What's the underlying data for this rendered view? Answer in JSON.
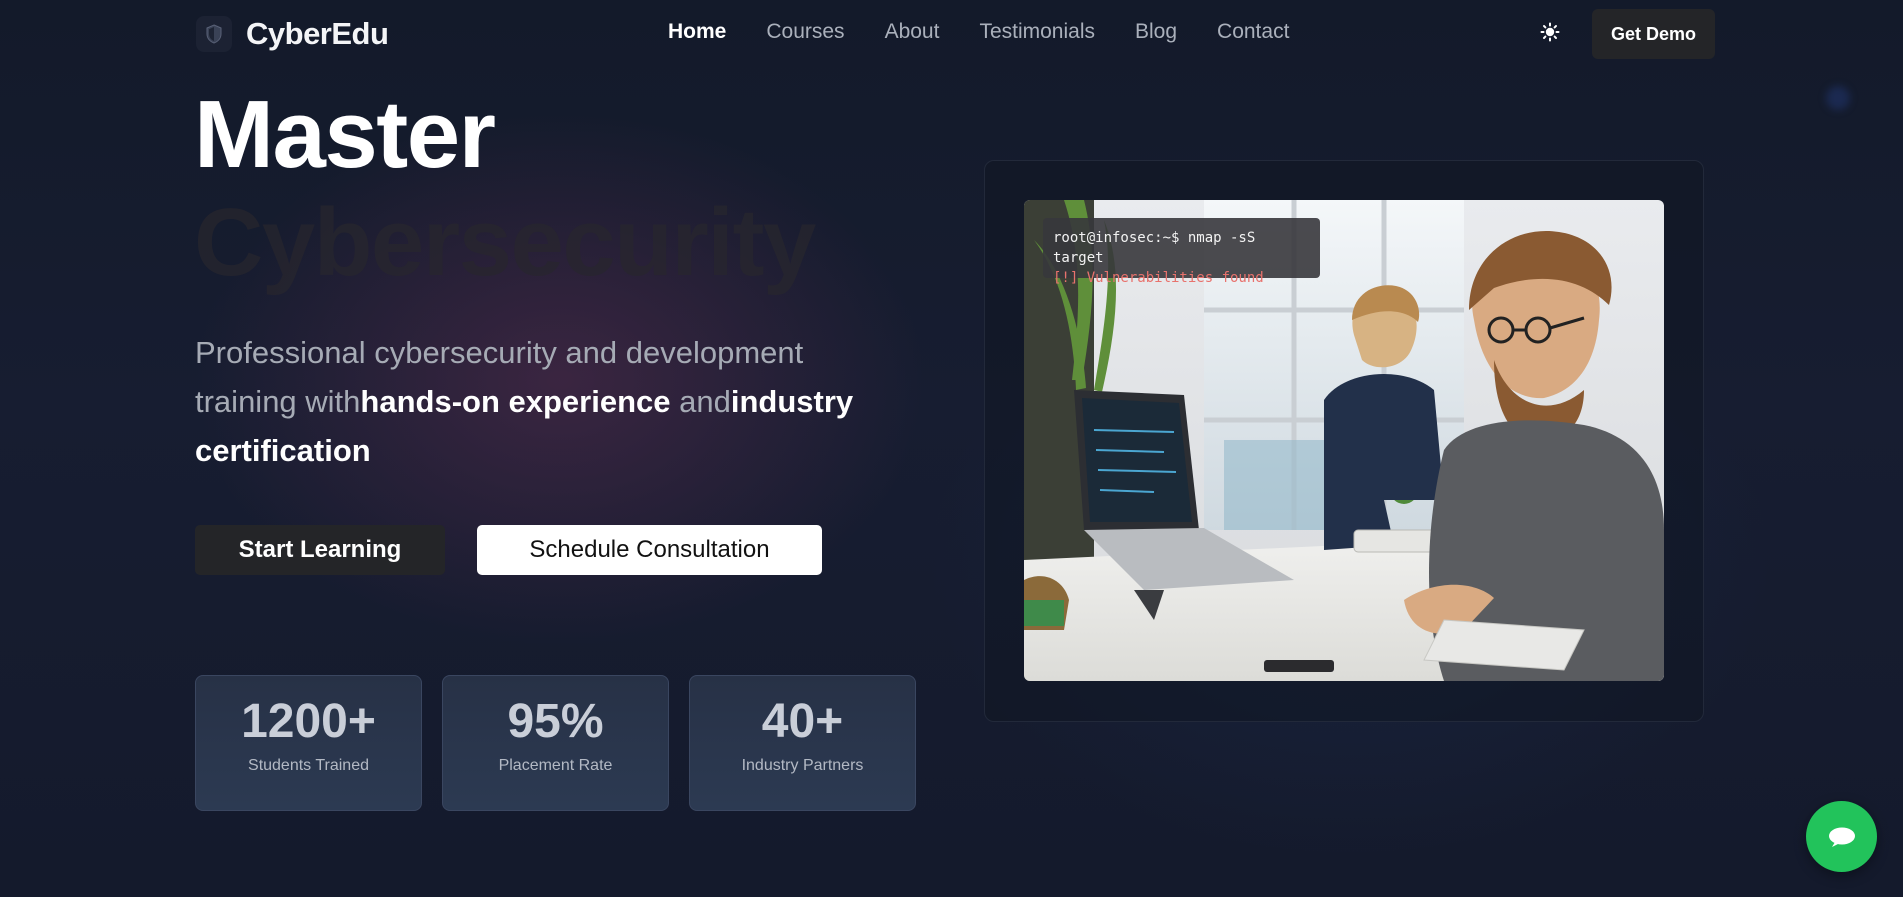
{
  "nav": {
    "brand": "CyberEdu",
    "brand_icon": "shield-icon",
    "items": [
      {
        "label": "Home",
        "active": true
      },
      {
        "label": "Courses",
        "active": false
      },
      {
        "label": "About",
        "active": false
      },
      {
        "label": "Testimonials",
        "active": false
      },
      {
        "label": "Blog",
        "active": false
      },
      {
        "label": "Contact",
        "active": false
      }
    ],
    "theme_icon": "sun-icon",
    "cta_label": "Get Demo"
  },
  "hero": {
    "title_line1": "Master",
    "title_line2": "Cybersecurity",
    "lead_part1": "Professional cybersecurity and development training with",
    "lead_highlight1": "hands-on experience",
    "lead_part2": " and",
    "lead_highlight2": "industry certification",
    "primary_button": "Start Learning",
    "secondary_button": "Schedule Consultation"
  },
  "stats": [
    {
      "value": "1200+",
      "label": "Students Trained"
    },
    {
      "value": "95%",
      "label": "Placement Rate"
    },
    {
      "value": "40+",
      "label": "Industry Partners"
    }
  ],
  "showcase": {
    "image": "office-coding-photo",
    "terminal_command": "root@infosec:~$ nmap -sS target",
    "terminal_output": "[!] Vulnerabilities found"
  },
  "chat_icon": "chat-bubble-icon",
  "colors": {
    "accent_green": "#22c35b",
    "terminal_warning": "#e8726d",
    "button_dark": "#242528"
  }
}
